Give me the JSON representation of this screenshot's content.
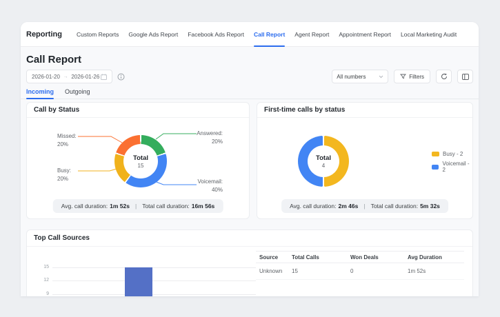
{
  "nav": {
    "brand": "Reporting",
    "items": [
      {
        "label": "Custom Reports",
        "active": false
      },
      {
        "label": "Google Ads Report",
        "active": false
      },
      {
        "label": "Facebook Ads Report",
        "active": false
      },
      {
        "label": "Call Report",
        "active": true
      },
      {
        "label": "Agent Report",
        "active": false
      },
      {
        "label": "Appointment Report",
        "active": false
      },
      {
        "label": "Local Marketing Audit",
        "active": false
      }
    ]
  },
  "header": {
    "title": "Call Report",
    "date_from": "2026-01-20",
    "date_arrow": "→",
    "date_to": "2026-01-26"
  },
  "controls": {
    "numbers_select": "All numbers",
    "filters_label": "Filters"
  },
  "tabs": [
    {
      "label": "Incoming",
      "active": true
    },
    {
      "label": "Outgoing",
      "active": false
    }
  ],
  "cards": {
    "status": {
      "title": "Call by Status",
      "center_label": "Total",
      "center_value": "15",
      "callouts": [
        {
          "name": "Missed:",
          "pct": "20%"
        },
        {
          "name": "Busy:",
          "pct": "20%"
        },
        {
          "name": "Answered:",
          "pct": "20%"
        },
        {
          "name": "Voicemail:",
          "pct": "40%"
        }
      ],
      "summary": {
        "avg_label": "Avg. call duration:",
        "avg_value": "1m 52s",
        "sep": "|",
        "total_label": "Total call duration:",
        "total_value": "16m 56s"
      }
    },
    "first": {
      "title": "First-time calls by status",
      "center_label": "Total",
      "center_value": "4",
      "legend": [
        {
          "label": "Busy - 2",
          "color": "#f3b71f"
        },
        {
          "label": "Voicemail - 2",
          "color": "#4285f4"
        }
      ],
      "summary": {
        "avg_label": "Avg. call duration:",
        "avg_value": "2m 46s",
        "sep": "|",
        "total_label": "Total call duration:",
        "total_value": "5m 32s"
      }
    },
    "top": {
      "title": "Top Call Sources",
      "yticks": [
        "15",
        "12",
        "9"
      ],
      "table": {
        "headers": [
          "Source",
          "Total Calls",
          "Won Deals",
          "Avg Duration"
        ],
        "rows": [
          [
            "Unknown",
            "15",
            "0",
            "1m 52s"
          ]
        ]
      }
    }
  },
  "colors": {
    "accent_blue": "#2b6cee",
    "donut_answered_green": "#34ad5d",
    "donut_voicemail_blue": "#4285f4",
    "donut_busy_yellow": "#f0b21c",
    "donut_missed_orange": "#fb7031",
    "bar_blue": "#5470c6"
  },
  "chart_data": [
    {
      "type": "pie",
      "title": "Call by Status",
      "labels": [
        "Answered",
        "Voicemail",
        "Busy",
        "Missed"
      ],
      "values": [
        3,
        6,
        3,
        3
      ],
      "percents": [
        "20%",
        "40%",
        "20%",
        "20%"
      ],
      "total": 15,
      "colors": [
        "#34ad5d",
        "#4285f4",
        "#f0b21c",
        "#fb7031"
      ],
      "legend_position": "callout-labels",
      "center_text": "Total 15"
    },
    {
      "type": "pie",
      "title": "First-time calls by status",
      "labels": [
        "Busy",
        "Voicemail"
      ],
      "values": [
        2,
        2
      ],
      "total": 4,
      "colors": [
        "#f3b71f",
        "#4285f4"
      ],
      "legend_position": "right",
      "center_text": "Total 4"
    },
    {
      "type": "bar",
      "title": "Top Call Sources",
      "categories": [
        "Unknown"
      ],
      "values": [
        15
      ],
      "ylim": [
        0,
        15
      ],
      "yticks": [
        15,
        12,
        9
      ],
      "color": "#5470c6",
      "grid": true
    }
  ]
}
